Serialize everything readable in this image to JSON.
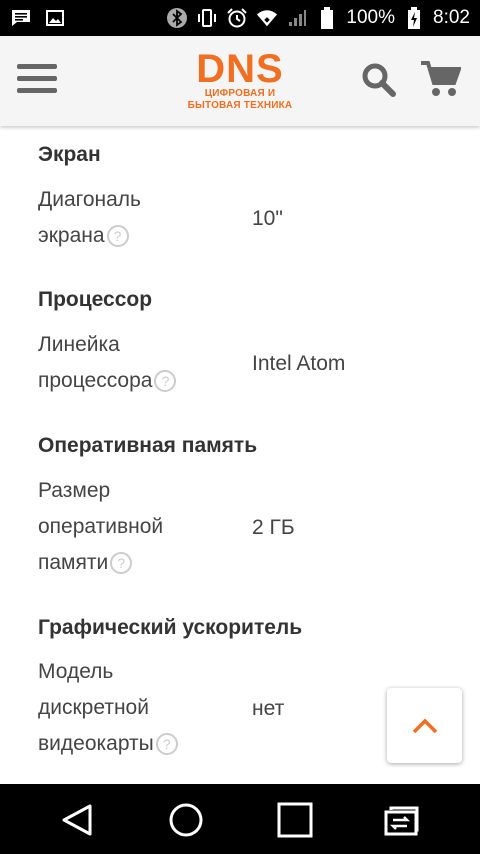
{
  "status_bar": {
    "battery_percent": "100%",
    "time": "8:02"
  },
  "header": {
    "logo_main": "DNS",
    "logo_sub_line1": "ЦИФРОВАЯ И",
    "logo_sub_line2": "БЫТОВАЯ ТЕХНИКА",
    "brand_color": "#f26f21"
  },
  "sections": [
    {
      "title": "Экран",
      "specs": [
        {
          "label_lines": [
            "Диагональ",
            "экрана"
          ],
          "value": "10\""
        }
      ]
    },
    {
      "title": "Процессор",
      "specs": [
        {
          "label_lines": [
            "Линейка",
            "процессора"
          ],
          "value": "Intel Atom"
        }
      ]
    },
    {
      "title": "Оперативная память",
      "specs": [
        {
          "label_lines": [
            "Размер",
            "оперативной",
            "памяти"
          ],
          "value": "2 ГБ"
        }
      ]
    },
    {
      "title": "Графический ускоритель",
      "specs": [
        {
          "label_lines": [
            "Модель",
            "дискретной",
            "видеокарты"
          ],
          "value": "нет"
        }
      ]
    }
  ],
  "help_glyph": "?",
  "scroll_top_color": "#f26f21"
}
